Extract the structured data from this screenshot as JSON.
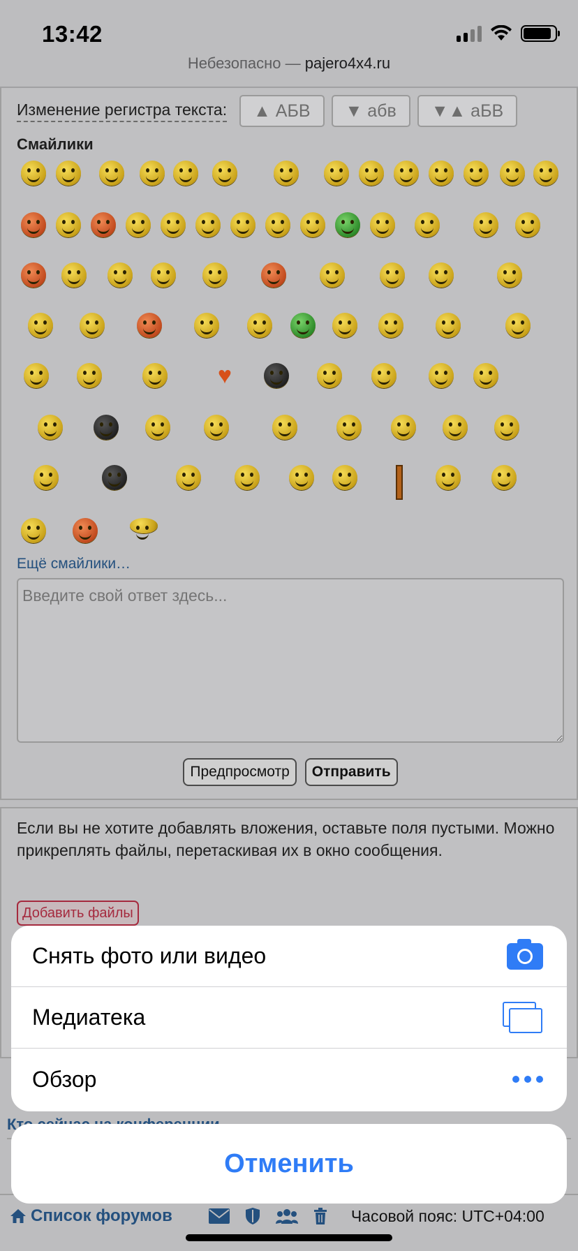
{
  "status_bar": {
    "time": "13:42"
  },
  "browser": {
    "url_prefix": "Небезопасно — ",
    "domain": "pajero4x4.ru"
  },
  "editor": {
    "case_label": "Изменение регистра текста:",
    "case_buttons": [
      {
        "label": "▲ АБВ"
      },
      {
        "label": "▼ абв"
      },
      {
        "label": "▼▲ аБВ"
      }
    ],
    "smilies_title": "Смайлики",
    "more_smilies": "Ещё смайлики…",
    "reply_placeholder": "Введите свой ответ здесь...",
    "preview_label": "Предпросмотр",
    "submit_label": "Отправить"
  },
  "attachments": {
    "note": "Если вы не хотите добавлять вложения, оставьте поля пустыми. Можно прикреплять файлы, перетаскивая их в окно сообщения.",
    "add_files_label": "Добавить файлы"
  },
  "partially_hidden_heading": "Кто сейчас на конференции",
  "footer": {
    "forums_label": "Список форумов",
    "timezone": "Часовой пояс: UTC+04:00"
  },
  "action_sheet": {
    "items": [
      {
        "label": "Снять фото или видео",
        "icon": "camera-icon"
      },
      {
        "label": "Медиатека",
        "icon": "photo-library-icon"
      },
      {
        "label": "Обзор",
        "icon": "more-dots-icon"
      }
    ],
    "cancel_label": "Отменить"
  }
}
